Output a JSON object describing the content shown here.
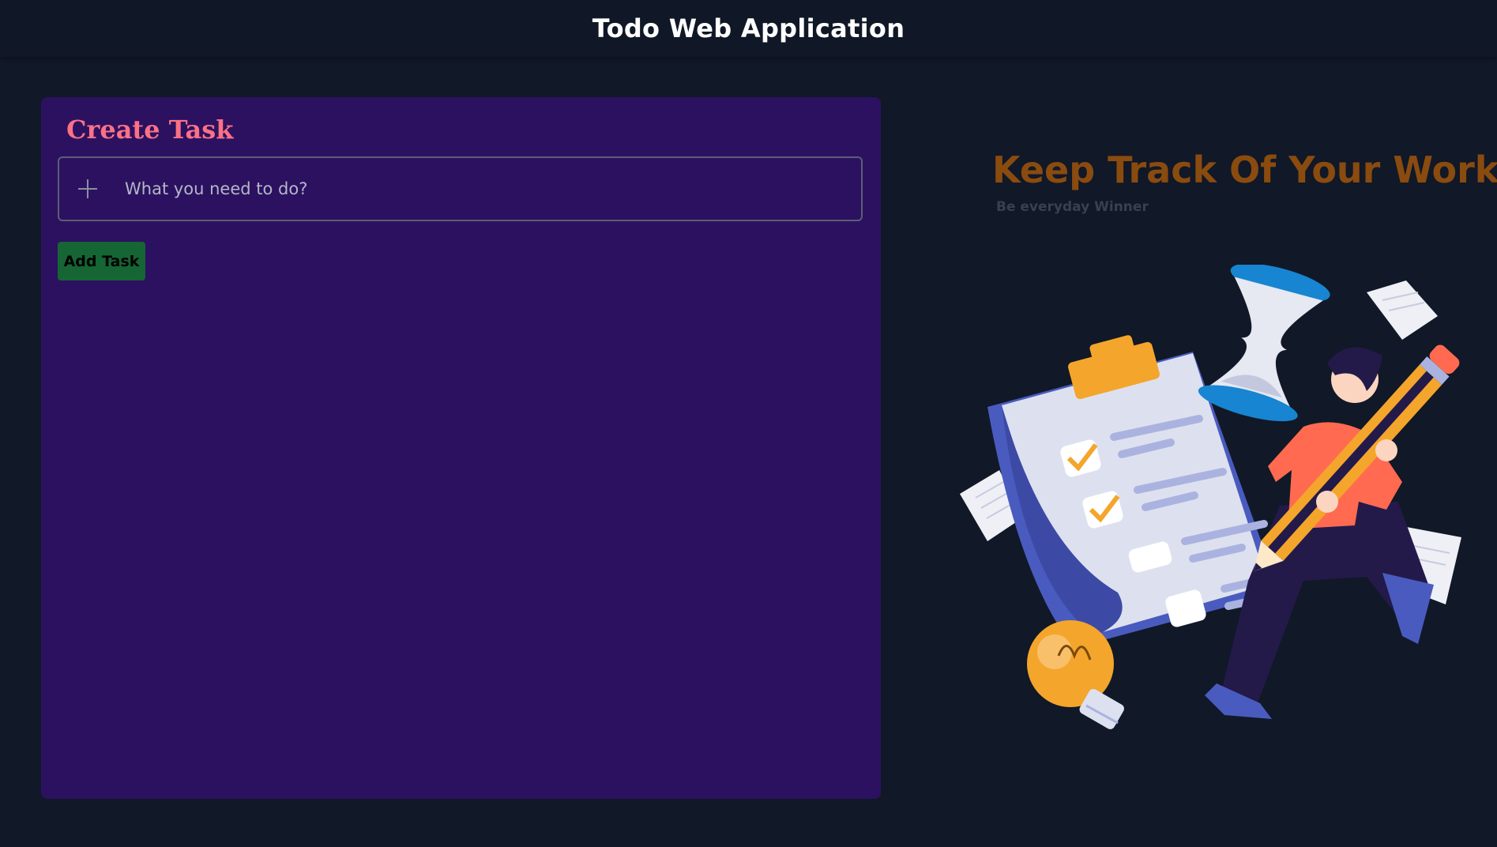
{
  "header": {
    "title": "Todo Web Application"
  },
  "create_task": {
    "title": "Create Task",
    "input_placeholder": "What you need to do?",
    "input_value": "",
    "add_button_label": "Add Task",
    "plus_icon": "plus-icon"
  },
  "hero": {
    "heading": "Keep Track Of Your Work",
    "subheading": "Be everyday Winner",
    "illustration": "todo-checklist-illustration"
  },
  "colors": {
    "background": "#111827",
    "panel": "#2c1161",
    "panel_title": "#fb7185",
    "add_button": "#166534",
    "hero_heading": "#8a4b0f",
    "hero_sub": "#374151"
  }
}
